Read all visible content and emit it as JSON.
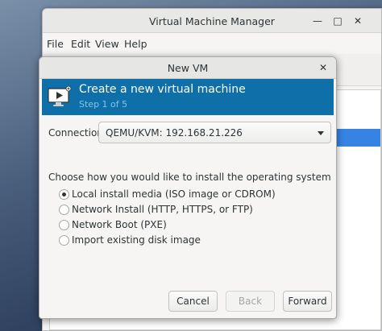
{
  "background_window": {
    "title": "Virtual Machine Manager",
    "menu": [
      "File",
      "Edit",
      "View",
      "Help"
    ],
    "controls": {
      "minimize": "—",
      "maximize": "□",
      "close": "✕"
    }
  },
  "dialog": {
    "title": "New VM",
    "close_glyph": "✕",
    "banner": {
      "title": "Create a new virtual machine",
      "step": "Step 1 of 5",
      "icon": "monitor-play-icon"
    },
    "connection": {
      "label": "Connection:",
      "value": "QEMU/KVM: 192.168.21.226"
    },
    "install_prompt": "Choose how you would like to install the operating system",
    "install_options": [
      {
        "label": "Local install media (ISO image or CDROM)",
        "selected": true
      },
      {
        "label": "Network Install (HTTP, HTTPS, or FTP)",
        "selected": false
      },
      {
        "label": "Network Boot (PXE)",
        "selected": false
      },
      {
        "label": "Import existing disk image",
        "selected": false
      }
    ],
    "buttons": {
      "cancel": "Cancel",
      "back": "Back",
      "forward": "Forward"
    }
  },
  "colors": {
    "banner": "#0f6fa8",
    "banner_step": "#86c3e6",
    "selection": "#3584e4"
  }
}
